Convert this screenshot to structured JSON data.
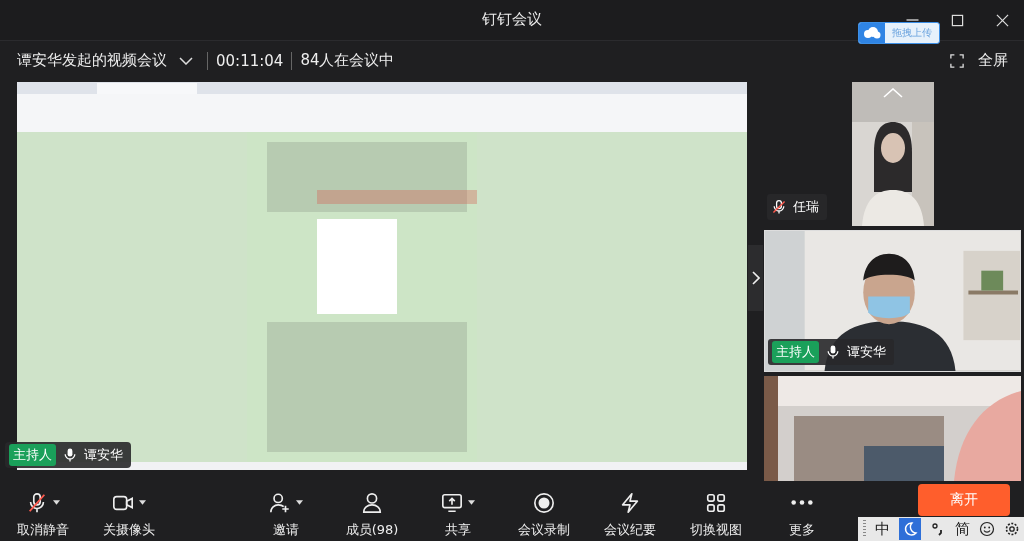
{
  "window": {
    "title": "钉钉会议"
  },
  "upload_badge": {
    "label": "拖拽上传"
  },
  "meeting": {
    "title": "谭安华发起的视频会议",
    "duration": "00:11:04",
    "participants": "84人在会议中",
    "fullscreen": "全屏"
  },
  "shared_screen": {
    "kind": "picture",
    "presenter": {
      "role": "主持人",
      "name": "谭安华",
      "muted": false
    }
  },
  "videos": [
    {
      "kind": "compact",
      "name": "任瑞",
      "muted": true
    },
    {
      "kind": "wide",
      "role": "主持人",
      "name": "谭安华",
      "muted": false
    },
    {
      "kind": "partial"
    }
  ],
  "toolbar": [
    {
      "kind": "mic-off",
      "label": "取消静音",
      "menu": true
    },
    {
      "kind": "camera",
      "label": "关摄像头",
      "menu": true
    },
    {
      "kind": "invite",
      "label": "邀请",
      "menu": true
    },
    {
      "kind": "members",
      "label": "成员(98)",
      "menu": false
    },
    {
      "kind": "share",
      "label": "共享",
      "menu": true
    },
    {
      "kind": "record",
      "label": "会议录制",
      "menu": false
    },
    {
      "kind": "summary",
      "label": "会议纪要",
      "menu": false
    },
    {
      "kind": "grid",
      "label": "切换视图",
      "menu": false
    },
    {
      "kind": "more",
      "label": "更多",
      "menu": false
    }
  ],
  "leave_button": "离开",
  "ime_bar": {
    "mode": "中",
    "script": "简"
  }
}
